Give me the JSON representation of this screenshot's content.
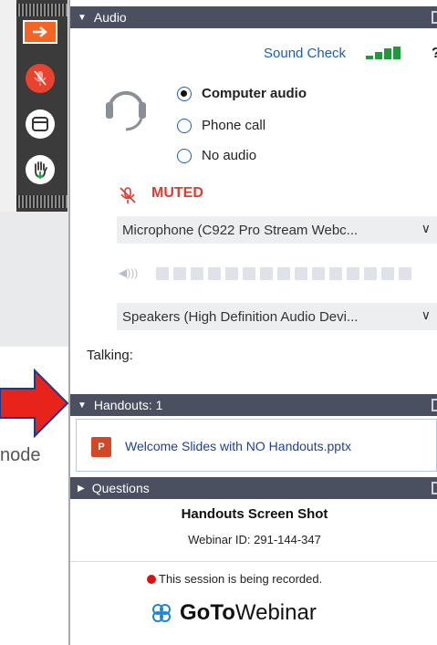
{
  "audio": {
    "header": "Audio",
    "sound_check": "Sound Check",
    "help": "?",
    "options": [
      {
        "label": "Computer audio",
        "selected": true
      },
      {
        "label": "Phone call",
        "selected": false
      },
      {
        "label": "No audio",
        "selected": false
      }
    ],
    "muted_label": "MUTED",
    "microphone": "Microphone (C922 Pro Stream Webc...",
    "speakers": "Speakers (High Definition Audio Devi...",
    "talking": "Talking:",
    "chevron": "∨"
  },
  "handouts": {
    "header": "Handouts: 1",
    "file_icon_letter": "P",
    "file": "Welcome Slides with NO Handouts.pptx"
  },
  "questions": {
    "header": "Questions",
    "title": "Handouts Screen Shot",
    "webinar_id": "Webinar ID: 291-144-347",
    "recording": "This session is being recorded."
  },
  "brand": {
    "go": "GoTo",
    "webinar": "Webinar"
  },
  "background_text": "node",
  "colors": {
    "header_bg": "#4a5060",
    "accent_orange": "#f26522",
    "muted_red": "#e23b2e",
    "link_blue": "#1b5fb5",
    "signal_green": "#1d9b3a",
    "arrow_red": "#e8231c"
  },
  "icons": [
    "arrow-right-icon",
    "mic-muted-icon",
    "window-icon",
    "raise-hand-icon",
    "headset-icon",
    "signal-bars-icon",
    "help-icon",
    "mic-muted-icon",
    "speaker-icon",
    "ppt-file-icon",
    "popout-icon",
    "record-dot-icon",
    "goto-logo-icon"
  ]
}
